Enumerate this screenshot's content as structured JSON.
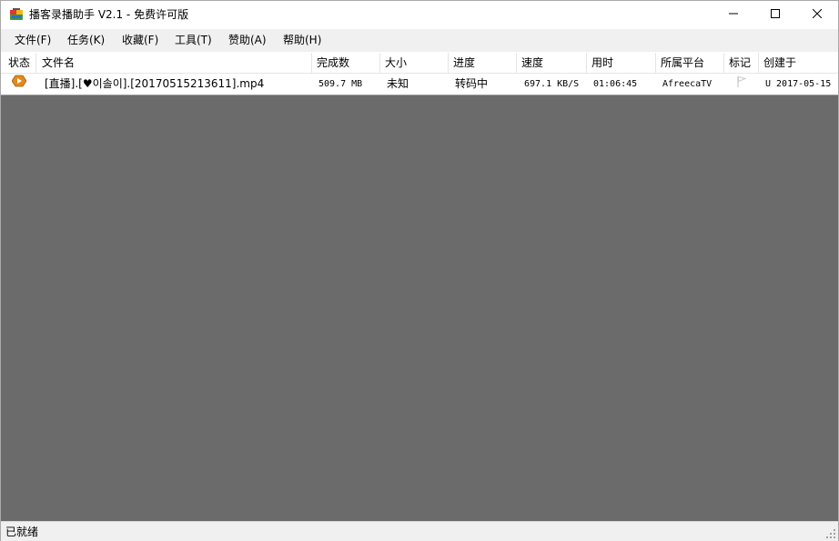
{
  "window": {
    "title": "播客录播助手 V2.1 - 免费许可版",
    "app_icon": "app-logo-icon",
    "controls": [
      "minimize-icon",
      "maximize-icon",
      "close-icon"
    ]
  },
  "menu": [
    {
      "label": "文件(F)"
    },
    {
      "label": "任务(K)"
    },
    {
      "label": "收藏(F)"
    },
    {
      "label": "工具(T)"
    },
    {
      "label": "赞助(A)"
    },
    {
      "label": "帮助(H)"
    }
  ],
  "columns": [
    {
      "label": "状态"
    },
    {
      "label": "文件名"
    },
    {
      "label": "完成数"
    },
    {
      "label": "大小"
    },
    {
      "label": "进度"
    },
    {
      "label": "速度"
    },
    {
      "label": "用时"
    },
    {
      "label": "所属平台"
    },
    {
      "label": "标记"
    },
    {
      "label": "创建于"
    }
  ],
  "rows": [
    {
      "status_icon": "recording-status-icon",
      "filename": "[直播].[♥이솔이].[20170515213611].mp4",
      "completed": "509.7 MB",
      "size": "未知",
      "progress": "转码中",
      "speed": "697.1 KB/S",
      "elapsed": "01:06:45",
      "platform": "AfreecaTV",
      "flag_icon": "flag-icon",
      "created": "U 2017-05-15"
    }
  ],
  "status": {
    "text": "已就绪",
    "grip_icon": "resize-grip-icon"
  },
  "colors": {
    "list_background": "#6b6b6b",
    "menubar_background": "#f0f0f0",
    "status_icon_orange": "#e08a1e"
  }
}
